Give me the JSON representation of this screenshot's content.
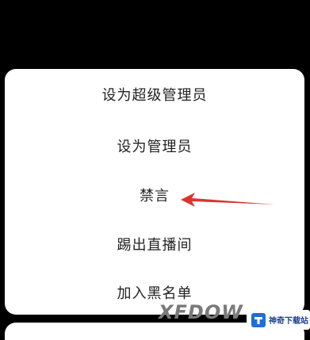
{
  "menu": {
    "items": [
      {
        "label": "设为超级管理员"
      },
      {
        "label": "设为管理员"
      },
      {
        "label": "禁言"
      },
      {
        "label": "踢出直播间"
      },
      {
        "label": "加入黑名单"
      }
    ]
  },
  "annotation": {
    "arrow_color": "#d9362f",
    "points_to": "禁言"
  },
  "watermark": {
    "text": "XFDOW",
    "logo_label": "神奇下载站"
  },
  "colors": {
    "background": "#000000",
    "sheet": "#ffffff",
    "text": "#222222"
  }
}
